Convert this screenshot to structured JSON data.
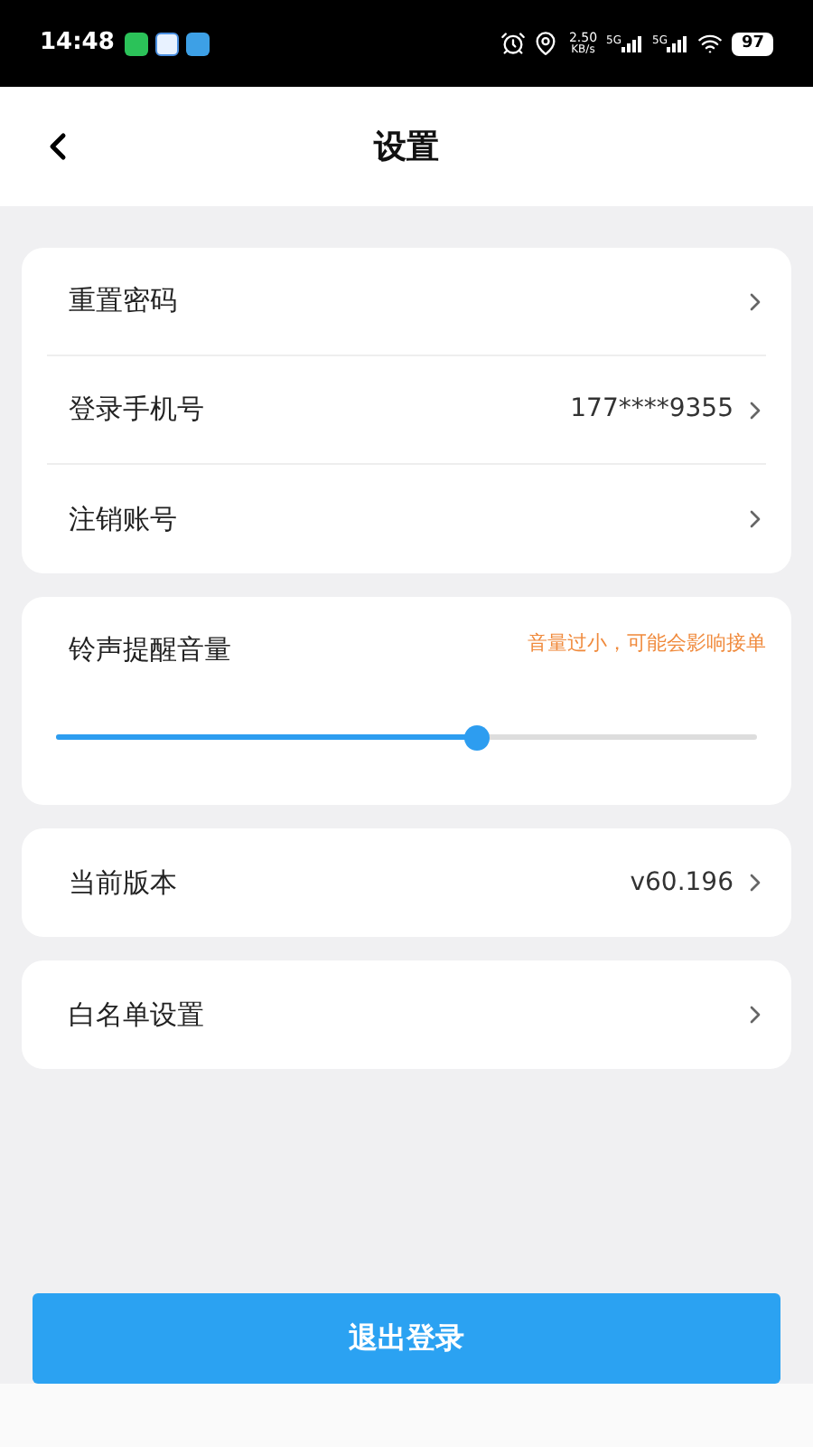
{
  "status_bar": {
    "time": "14:48",
    "net_speed": "2.50",
    "net_unit": "KB/s",
    "signals": [
      "5G",
      "5G"
    ],
    "battery": "97"
  },
  "header": {
    "title": "设置"
  },
  "groups": [
    {
      "items": [
        {
          "label": "重置密码"
        },
        {
          "label": "登录手机号",
          "value": "177****9355"
        },
        {
          "label": "注销账号"
        }
      ]
    }
  ],
  "volume": {
    "label": "铃声提醒音量",
    "warning": "音量过小，可能会影响接单",
    "level": 0.6
  },
  "groups2": [
    {
      "items": [
        {
          "label": "当前版本",
          "value": "v60.196"
        }
      ]
    },
    {
      "items": [
        {
          "label": "白名单设置"
        }
      ]
    }
  ],
  "logout": "退出登录"
}
